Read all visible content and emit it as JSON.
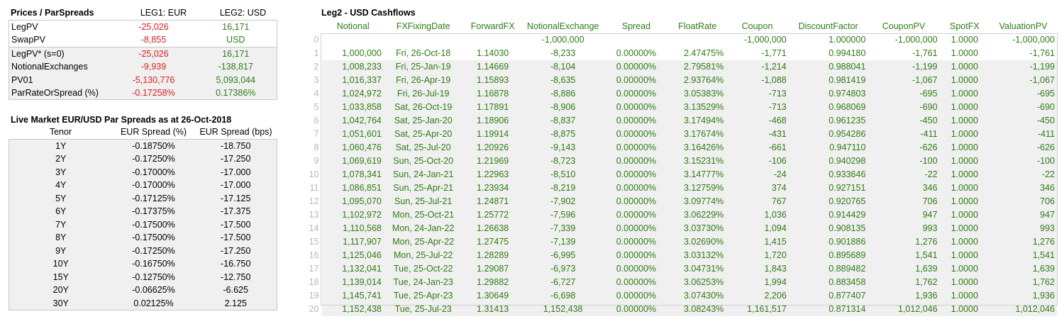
{
  "prices": {
    "title": "Prices / ParSpreads",
    "col1": "LEG1: EUR",
    "col2": "LEG2: USD",
    "rows": [
      {
        "label": "LegPV",
        "leg1": "-25,026",
        "leg2": "16,171"
      },
      {
        "label": "SwapPV",
        "leg1": "-8,855",
        "leg2": "USD"
      },
      {
        "label": "LegPV* (s=0)",
        "leg1": "-25,026",
        "leg2": "16,171"
      },
      {
        "label": "NotionalExchanges",
        "leg1": "-9,939",
        "leg2": "-138,817"
      },
      {
        "label": "PV01",
        "leg1": "-5,130,776",
        "leg2": "5,093,044"
      },
      {
        "label": "ParRateOrSpread (%)",
        "leg1": "-0.17258%",
        "leg2": "0.17386%"
      }
    ]
  },
  "spreads": {
    "title": "Live Market EUR/USD Par Spreads as at 26-Oct-2018",
    "headers": [
      "Tenor",
      "EUR Spread (%)",
      "EUR Spread (bps)"
    ],
    "rows": [
      [
        "1Y",
        "-0.18750%",
        "-18.750"
      ],
      [
        "2Y",
        "-0.17250%",
        "-17.250"
      ],
      [
        "3Y",
        "-0.17000%",
        "-17.000"
      ],
      [
        "4Y",
        "-0.17000%",
        "-17.000"
      ],
      [
        "5Y",
        "-0.17125%",
        "-17.125"
      ],
      [
        "6Y",
        "-0.17375%",
        "-17.375"
      ],
      [
        "7Y",
        "-0.17500%",
        "-17.500"
      ],
      [
        "8Y",
        "-0.17500%",
        "-17.500"
      ],
      [
        "9Y",
        "-0.17250%",
        "-17.250"
      ],
      [
        "10Y",
        "-0.16750%",
        "-16.750"
      ],
      [
        "15Y",
        "-0.12750%",
        "-12.750"
      ],
      [
        "20Y",
        "-0.06625%",
        "-6.625"
      ],
      [
        "30Y",
        "0.02125%",
        "2.125"
      ]
    ]
  },
  "cashflows": {
    "title": "Leg2 - USD Cashflows",
    "headers": [
      "Notional",
      "FXFixingDate",
      "ForwardFX",
      "NotionalExchange",
      "Spread",
      "FloatRate",
      "Coupon",
      "DiscountFactor",
      "CouponPV",
      "SpotFX",
      "ValuationPV"
    ],
    "rows": [
      [
        "0",
        "",
        "",
        "",
        "-1,000,000",
        "",
        "",
        "-1,000,000",
        "1.000000",
        "-1,000,000",
        "1.0000",
        "-1,000,000"
      ],
      [
        "1",
        "1,000,000",
        "Fri, 26-Oct-18",
        "1.14030",
        "-8,233",
        "0.00000%",
        "2.47475%",
        "-1,771",
        "0.994180",
        "-1,761",
        "1.0000",
        "-1,761"
      ],
      [
        "2",
        "1,008,233",
        "Fri, 25-Jan-19",
        "1.14669",
        "-8,104",
        "0.00000%",
        "2.79581%",
        "-1,214",
        "0.988041",
        "-1,199",
        "1.0000",
        "-1,199"
      ],
      [
        "3",
        "1,016,337",
        "Fri, 26-Apr-19",
        "1.15893",
        "-8,635",
        "0.00000%",
        "2.93764%",
        "-1,088",
        "0.981419",
        "-1,067",
        "1.0000",
        "-1,067"
      ],
      [
        "4",
        "1,024,972",
        "Fri, 26-Jul-19",
        "1.16878",
        "-8,886",
        "0.00000%",
        "3.05383%",
        "-713",
        "0.974803",
        "-695",
        "1.0000",
        "-695"
      ],
      [
        "5",
        "1,033,858",
        "Sat, 26-Oct-19",
        "1.17891",
        "-8,906",
        "0.00000%",
        "3.13529%",
        "-713",
        "0.968069",
        "-690",
        "1.0000",
        "-690"
      ],
      [
        "6",
        "1,042,764",
        "Sat, 25-Jan-20",
        "1.18906",
        "-8,837",
        "0.00000%",
        "3.17494%",
        "-468",
        "0.961235",
        "-450",
        "1.0000",
        "-450"
      ],
      [
        "7",
        "1,051,601",
        "Sat, 25-Apr-20",
        "1.19914",
        "-8,875",
        "0.00000%",
        "3.17674%",
        "-431",
        "0.954286",
        "-411",
        "1.0000",
        "-411"
      ],
      [
        "8",
        "1,060,476",
        "Sat, 25-Jul-20",
        "1.20926",
        "-9,143",
        "0.00000%",
        "3.16426%",
        "-661",
        "0.947110",
        "-626",
        "1.0000",
        "-626"
      ],
      [
        "9",
        "1,069,619",
        "Sun, 25-Oct-20",
        "1.21969",
        "-8,723",
        "0.00000%",
        "3.15231%",
        "-106",
        "0.940298",
        "-100",
        "1.0000",
        "-100"
      ],
      [
        "10",
        "1,078,341",
        "Sun, 24-Jan-21",
        "1.22963",
        "-8,510",
        "0.00000%",
        "3.14777%",
        "-24",
        "0.933646",
        "-22",
        "1.0000",
        "-22"
      ],
      [
        "11",
        "1,086,851",
        "Sun, 25-Apr-21",
        "1.23934",
        "-8,219",
        "0.00000%",
        "3.12759%",
        "374",
        "0.927151",
        "346",
        "1.0000",
        "346"
      ],
      [
        "12",
        "1,095,070",
        "Sun, 25-Jul-21",
        "1.24871",
        "-7,902",
        "0.00000%",
        "3.09774%",
        "767",
        "0.920765",
        "706",
        "1.0000",
        "706"
      ],
      [
        "13",
        "1,102,972",
        "Mon, 25-Oct-21",
        "1.25772",
        "-7,596",
        "0.00000%",
        "3.06229%",
        "1,036",
        "0.914429",
        "947",
        "1.0000",
        "947"
      ],
      [
        "14",
        "1,110,568",
        "Mon, 24-Jan-22",
        "1.26638",
        "-7,339",
        "0.00000%",
        "3.03730%",
        "1,094",
        "0.908135",
        "993",
        "1.0000",
        "993"
      ],
      [
        "15",
        "1,117,907",
        "Mon, 25-Apr-22",
        "1.27475",
        "-7,139",
        "0.00000%",
        "3.02690%",
        "1,415",
        "0.901886",
        "1,276",
        "1.0000",
        "1,276"
      ],
      [
        "16",
        "1,125,046",
        "Mon, 25-Jul-22",
        "1.28289",
        "-6,995",
        "0.00000%",
        "3.03132%",
        "1,720",
        "0.895689",
        "1,541",
        "1.0000",
        "1,541"
      ],
      [
        "17",
        "1,132,041",
        "Tue, 25-Oct-22",
        "1.29087",
        "-6,973",
        "0.00000%",
        "3.04731%",
        "1,843",
        "0.889482",
        "1,639",
        "1.0000",
        "1,639"
      ],
      [
        "18",
        "1,139,014",
        "Tue, 24-Jan-23",
        "1.29882",
        "-6,727",
        "0.00000%",
        "3.06253%",
        "1,994",
        "0.883458",
        "1,762",
        "1.0000",
        "1,762"
      ],
      [
        "19",
        "1,145,741",
        "Tue, 25-Apr-23",
        "1.30649",
        "-6,698",
        "0.00000%",
        "3.07430%",
        "2,206",
        "0.877407",
        "1,936",
        "1.0000",
        "1,936"
      ],
      [
        "20",
        "1,152,438",
        "Tue, 25-Jul-23",
        "1.31413",
        "1,152,438",
        "0.00000%",
        "3.08243%",
        "1,161,517",
        "0.871314",
        "1,012,046",
        "1.0000",
        "1,012,046"
      ]
    ]
  }
}
